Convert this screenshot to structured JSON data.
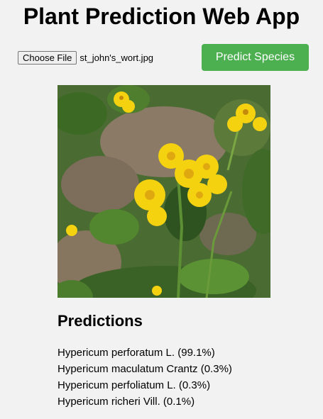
{
  "header": {
    "title": "Plant Prediction Web App"
  },
  "upload": {
    "choose_label": "Choose File",
    "file_name": "st_john's_wort.jpg"
  },
  "actions": {
    "predict_label": "Predict Species"
  },
  "colors": {
    "accent": "#4caf50",
    "background": "#f2f2f2",
    "flower": "#f5d20f",
    "foliage": "#3f5a2a"
  },
  "preview": {
    "subject": "yellow-flowering-plant-photo"
  },
  "predictions": {
    "heading": "Predictions",
    "items": [
      "Hypericum perforatum L. (99.1%)",
      "Hypericum maculatum Crantz (0.3%)",
      "Hypericum perfoliatum L. (0.3%)",
      "Hypericum richeri Vill. (0.1%)"
    ]
  }
}
